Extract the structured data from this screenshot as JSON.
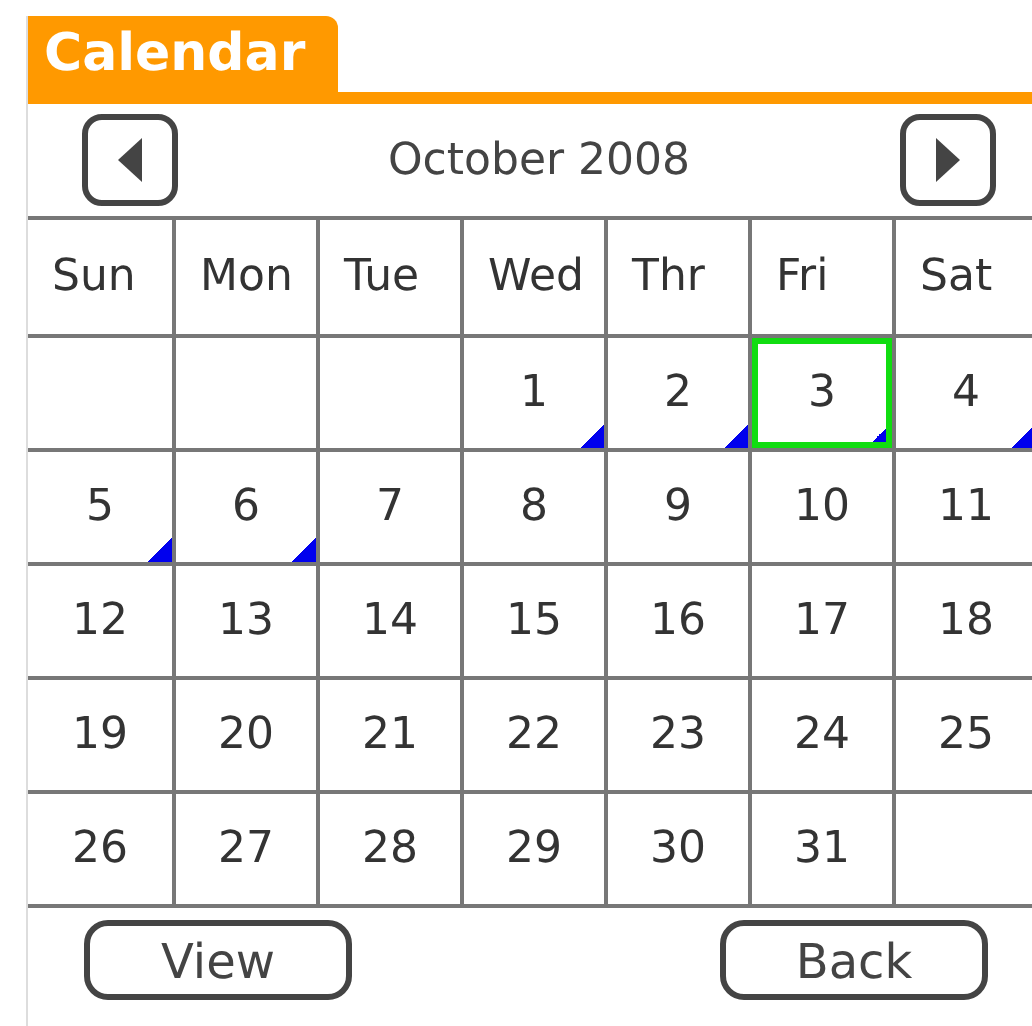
{
  "title": "Calendar",
  "month": "October 2008",
  "weekdays": [
    "Sun",
    "Mon",
    "Tue",
    "Wed",
    "Thr",
    "Fri",
    "Sat"
  ],
  "weeks": [
    [
      {
        "kind": "blank"
      },
      {
        "kind": "blank"
      },
      {
        "kind": "blank"
      },
      {
        "kind": "day",
        "day": "1",
        "has_event": true,
        "selected": false
      },
      {
        "kind": "day",
        "day": "2",
        "has_event": true,
        "selected": false
      },
      {
        "kind": "day",
        "day": "3",
        "has_event": true,
        "selected": true
      },
      {
        "kind": "day",
        "day": "4",
        "has_event": true,
        "selected": false
      }
    ],
    [
      {
        "kind": "day",
        "day": "5",
        "has_event": true,
        "selected": false
      },
      {
        "kind": "day",
        "day": "6",
        "has_event": true,
        "selected": false
      },
      {
        "kind": "day",
        "day": "7",
        "has_event": false,
        "selected": false
      },
      {
        "kind": "day",
        "day": "8",
        "has_event": false,
        "selected": false
      },
      {
        "kind": "day",
        "day": "9",
        "has_event": false,
        "selected": false
      },
      {
        "kind": "day",
        "day": "10",
        "has_event": false,
        "selected": false
      },
      {
        "kind": "day",
        "day": "11",
        "has_event": false,
        "selected": false
      }
    ],
    [
      {
        "kind": "day",
        "day": "12",
        "has_event": false,
        "selected": false
      },
      {
        "kind": "day",
        "day": "13",
        "has_event": false,
        "selected": false
      },
      {
        "kind": "day",
        "day": "14",
        "has_event": false,
        "selected": false
      },
      {
        "kind": "day",
        "day": "15",
        "has_event": false,
        "selected": false
      },
      {
        "kind": "day",
        "day": "16",
        "has_event": false,
        "selected": false
      },
      {
        "kind": "day",
        "day": "17",
        "has_event": false,
        "selected": false
      },
      {
        "kind": "day",
        "day": "18",
        "has_event": false,
        "selected": false
      }
    ],
    [
      {
        "kind": "day",
        "day": "19",
        "has_event": false,
        "selected": false
      },
      {
        "kind": "day",
        "day": "20",
        "has_event": false,
        "selected": false
      },
      {
        "kind": "day",
        "day": "21",
        "has_event": false,
        "selected": false
      },
      {
        "kind": "day",
        "day": "22",
        "has_event": false,
        "selected": false
      },
      {
        "kind": "day",
        "day": "23",
        "has_event": false,
        "selected": false
      },
      {
        "kind": "day",
        "day": "24",
        "has_event": false,
        "selected": false
      },
      {
        "kind": "day",
        "day": "25",
        "has_event": false,
        "selected": false
      }
    ],
    [
      {
        "kind": "day",
        "day": "26",
        "has_event": false,
        "selected": false
      },
      {
        "kind": "day",
        "day": "27",
        "has_event": false,
        "selected": false
      },
      {
        "kind": "day",
        "day": "28",
        "has_event": false,
        "selected": false
      },
      {
        "kind": "day",
        "day": "29",
        "has_event": false,
        "selected": false
      },
      {
        "kind": "day",
        "day": "30",
        "has_event": false,
        "selected": false
      },
      {
        "kind": "day",
        "day": "31",
        "has_event": false,
        "selected": false
      },
      {
        "kind": "blank"
      }
    ]
  ],
  "buttons": [
    "View",
    "Back"
  ]
}
